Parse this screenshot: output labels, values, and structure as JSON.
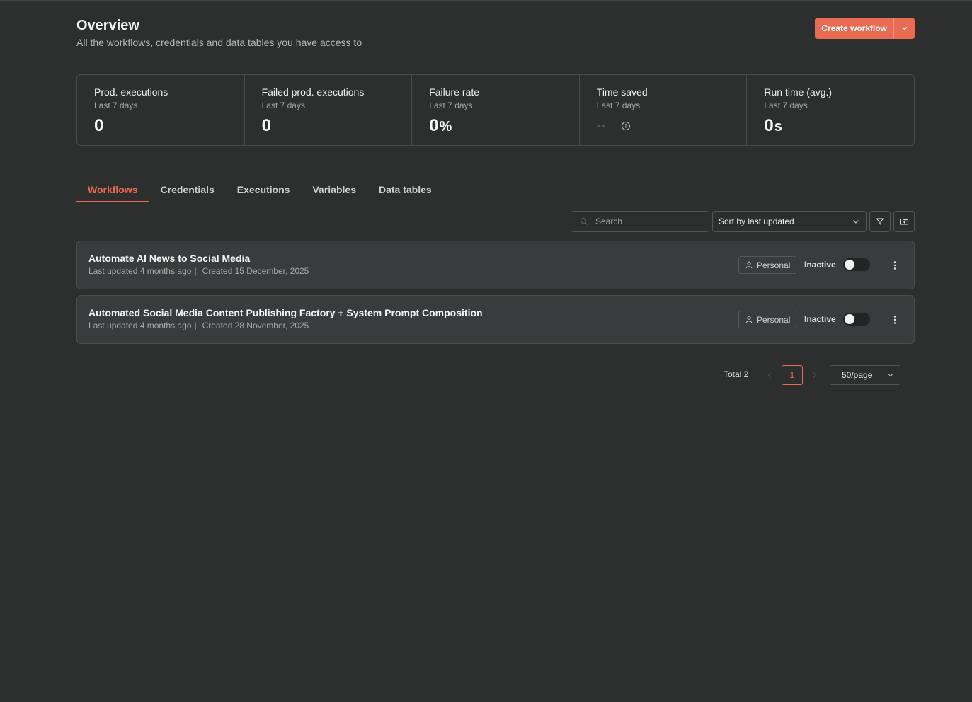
{
  "header": {
    "title": "Overview",
    "subtitle": "All the workflows, credentials and data tables you have access to",
    "create_label": "Create workflow"
  },
  "stats": [
    {
      "label": "Prod. executions",
      "period": "Last 7 days",
      "value": "0",
      "unit": ""
    },
    {
      "label": "Failed prod. executions",
      "period": "Last 7 days",
      "value": "0",
      "unit": ""
    },
    {
      "label": "Failure rate",
      "period": "Last 7 days",
      "value": "0",
      "unit": "%"
    },
    {
      "label": "Time saved",
      "period": "Last 7 days",
      "value": "--",
      "unit": ""
    },
    {
      "label": "Run time (avg.)",
      "period": "Last 7 days",
      "value": "0",
      "unit": "s"
    }
  ],
  "tabs": [
    {
      "label": "Workflows",
      "active": true
    },
    {
      "label": "Credentials",
      "active": false
    },
    {
      "label": "Executions",
      "active": false
    },
    {
      "label": "Variables",
      "active": false
    },
    {
      "label": "Data tables",
      "active": false
    }
  ],
  "toolbar": {
    "search_placeholder": "Search",
    "sort_label": "Sort by last updated"
  },
  "workflows": [
    {
      "name": "Automate AI News to Social Media",
      "updated": "Last updated 4 months ago",
      "separator": "|",
      "created": "Created 15 December, 2025",
      "owner": "Personal",
      "status": "Inactive",
      "active": false
    },
    {
      "name": "Automated Social Media Content Publishing Factory + System Prompt Composition",
      "updated": "Last updated 4 months ago",
      "separator": "|",
      "created": "Created 28 November, 2025",
      "owner": "Personal",
      "status": "Inactive",
      "active": false
    }
  ],
  "pagination": {
    "total_label": "Total 2",
    "current_page": "1",
    "page_size_label": "50/page"
  },
  "colors": {
    "accent": "#ea6b54",
    "background": "#2d2e2e",
    "card": "#3a3b3c"
  }
}
